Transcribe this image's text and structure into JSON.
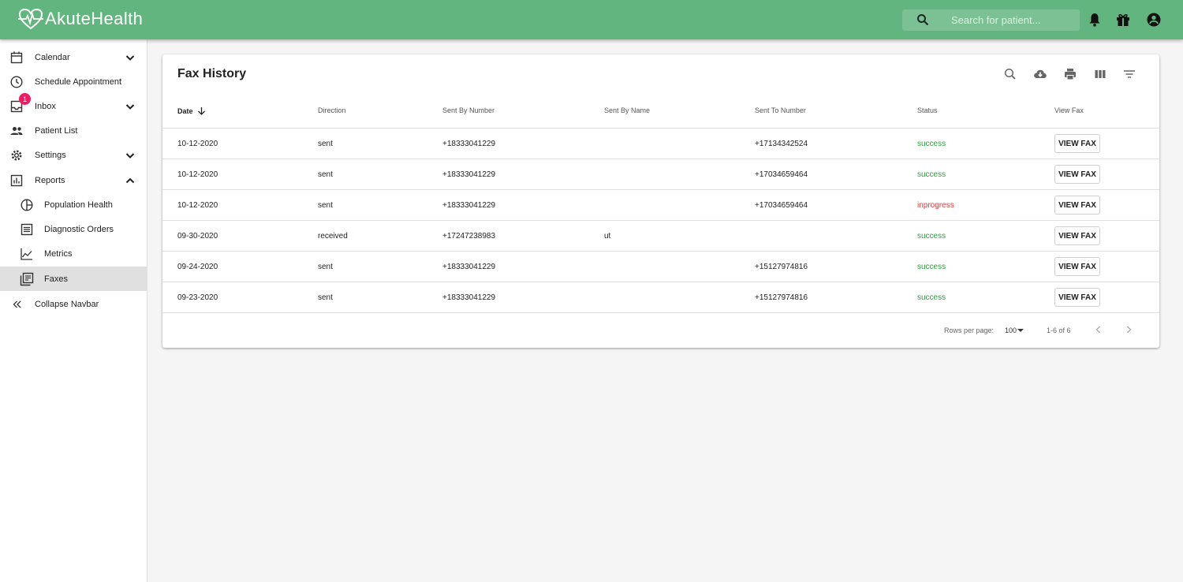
{
  "app": {
    "brand": "AkuteHealth"
  },
  "header": {
    "search_placeholder": "Search for patient..."
  },
  "sidebar": {
    "items": [
      {
        "label": "Calendar"
      },
      {
        "label": "Schedule Appointment"
      },
      {
        "label": "Inbox",
        "badge": "1"
      },
      {
        "label": "Patient List"
      },
      {
        "label": "Settings"
      },
      {
        "label": "Reports"
      },
      {
        "label": "Population Health"
      },
      {
        "label": "Diagnostic Orders"
      },
      {
        "label": "Metrics"
      },
      {
        "label": "Faxes"
      },
      {
        "label": "Collapse Navbar"
      }
    ]
  },
  "fax_history": {
    "title": "Fax History",
    "columns": [
      "Date",
      "Direction",
      "Sent By Number",
      "Sent By Name",
      "Sent To Number",
      "Status",
      "View Fax"
    ],
    "view_label": "VIEW FAX",
    "rows": [
      [
        "10-12-2020",
        "sent",
        "+18333041229",
        "",
        "+17134342524",
        "success"
      ],
      [
        "10-12-2020",
        "sent",
        "+18333041229",
        "",
        "+17034659464",
        "success"
      ],
      [
        "10-12-2020",
        "sent",
        "+18333041229",
        "",
        "+17034659464",
        "inprogress"
      ],
      [
        "09-30-2020",
        "received",
        "+17247238983",
        "ut",
        "",
        "success"
      ],
      [
        "09-24-2020",
        "sent",
        "+18333041229",
        "",
        "+15127974816",
        "success"
      ],
      [
        "09-23-2020",
        "sent",
        "+18333041229",
        "",
        "+15127974816",
        "success"
      ]
    ],
    "pagination": {
      "rows_label": "Rows per page:",
      "rows_value": "100",
      "range": "1-6 of 6"
    }
  },
  "colors": {
    "brand_green": "#62b57e",
    "success": "#2e9b3d",
    "inprogress": "#e53935",
    "badge": "#e91e63"
  }
}
